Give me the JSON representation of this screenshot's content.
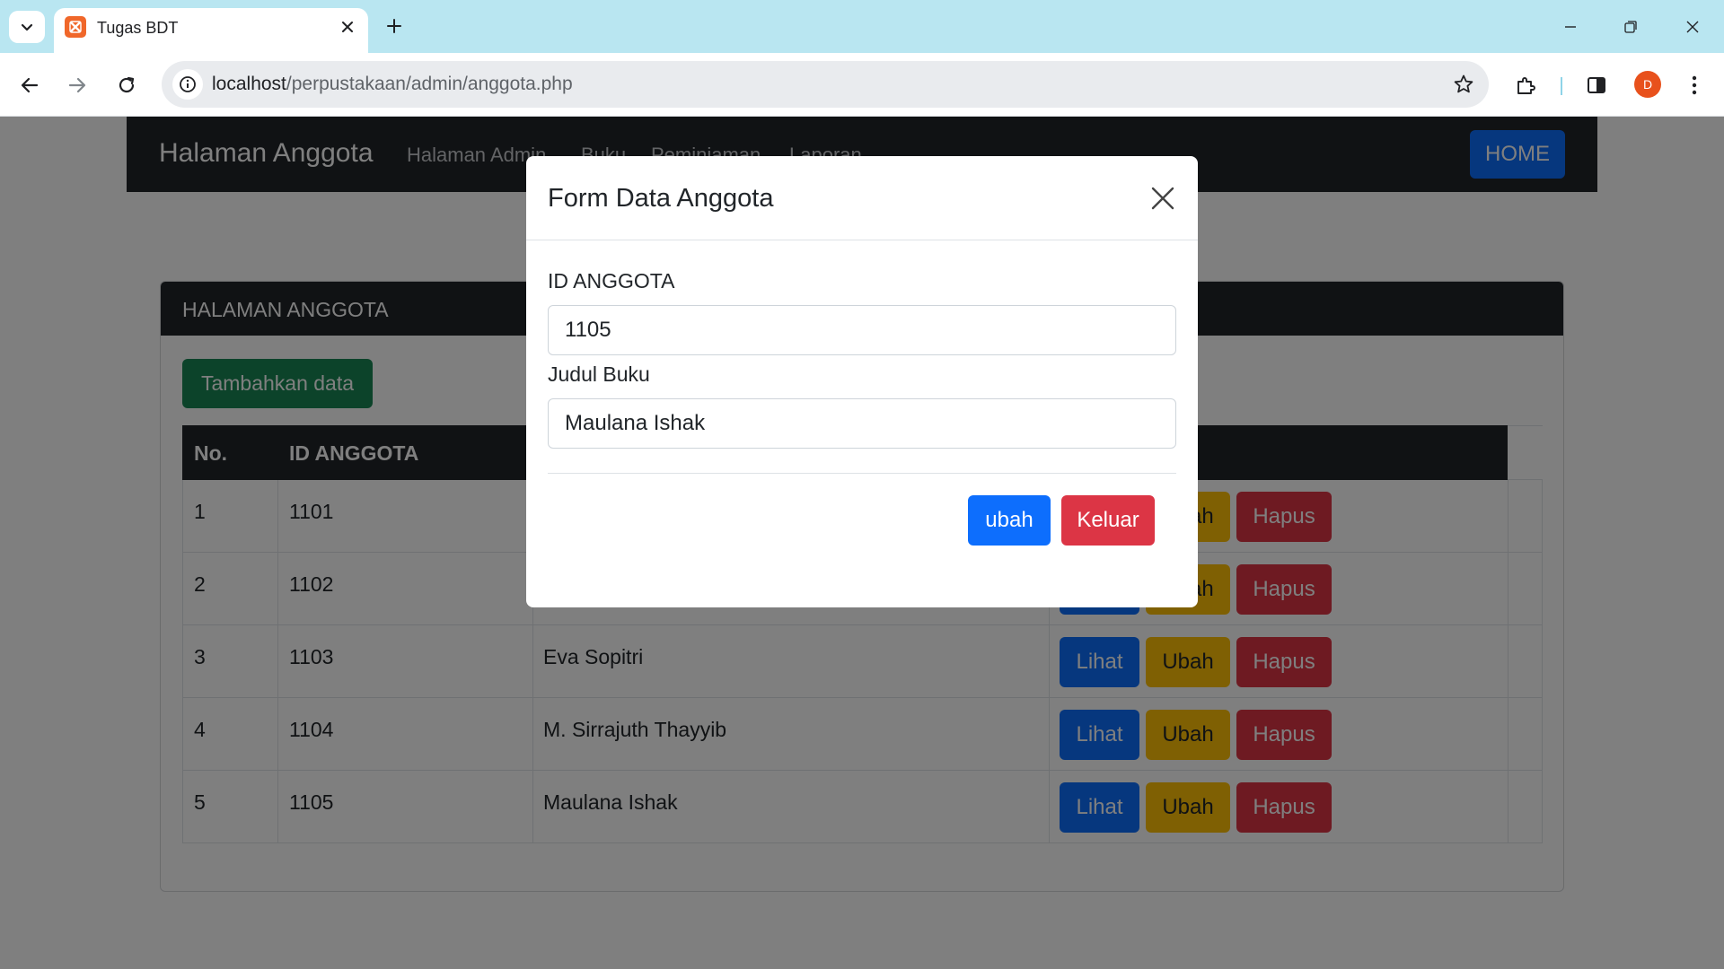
{
  "browser": {
    "tab_title": "Tugas BDT",
    "url_host": "localhost",
    "url_path": "/perpustakaan/admin/anggota.php",
    "profile_initial": "D"
  },
  "navbar": {
    "brand": "Halaman Anggota",
    "links": [
      "Halaman Admin",
      "Buku",
      "Peminjaman",
      "Laporan"
    ],
    "home_label": "HOME"
  },
  "card": {
    "title": "HALAMAN ANGGOTA",
    "add_label": "Tambahkan data"
  },
  "table": {
    "headers": [
      "No.",
      "ID ANGGOTA"
    ],
    "rows": [
      {
        "no": "1",
        "id": "1101",
        "name": ""
      },
      {
        "no": "2",
        "id": "1102",
        "name": ""
      },
      {
        "no": "3",
        "id": "1103",
        "name": "Eva Sopitri"
      },
      {
        "no": "4",
        "id": "1104",
        "name": "M. Sirrajuth Thayyib"
      },
      {
        "no": "5",
        "id": "1105",
        "name": "Maulana Ishak"
      }
    ],
    "action_lihat": "Lihat",
    "action_ubah": "Ubah",
    "action_hapus": "Hapus"
  },
  "modal": {
    "title": "Form Data Anggota",
    "field1_label": "ID ANGGOTA",
    "field1_value": "1105",
    "field2_label": "Judul Buku",
    "field2_value": "Maulana Ishak",
    "submit_label": "ubah",
    "exit_label": "Keluar"
  },
  "colors": {
    "primary": "#0d6efd",
    "success": "#198754",
    "warning": "#ffc107",
    "danger": "#dc3545",
    "dark": "#212529",
    "tabbar": "#b9e6f1"
  }
}
